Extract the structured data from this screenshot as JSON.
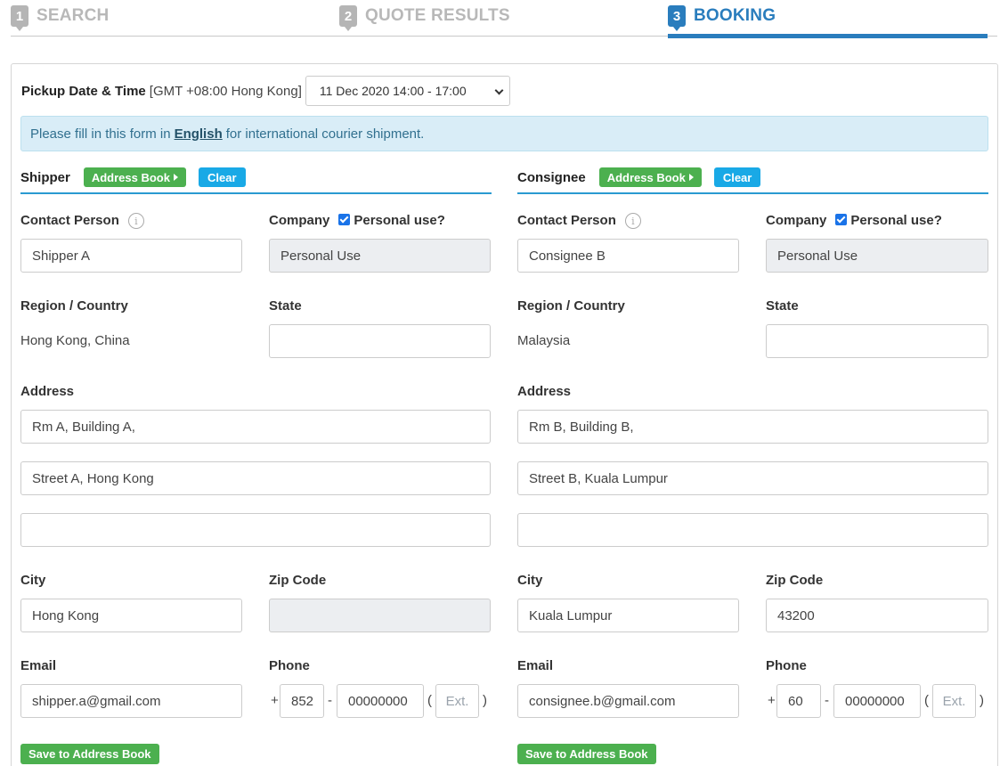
{
  "steps": [
    {
      "number": "1",
      "label": "SEARCH"
    },
    {
      "number": "2",
      "label": "QUOTE RESULTS"
    },
    {
      "number": "3",
      "label": "BOOKING"
    }
  ],
  "pickup": {
    "label": "Pickup Date & Time",
    "timezone": "[GMT +08:00 Hong Kong]",
    "selected": "11 Dec 2020 14:00 - 17:00"
  },
  "notice": {
    "before": "Please fill in this form in",
    "emphasis": "English",
    "after": "for international courier shipment."
  },
  "labels": {
    "address_book": "Address Book",
    "clear": "Clear",
    "contact_person": "Contact Person",
    "company": "Company",
    "personal_use": "Personal use?",
    "region_country": "Region / Country",
    "state": "State",
    "address": "Address",
    "city": "City",
    "zip_code": "Zip Code",
    "email": "Email",
    "phone": "Phone",
    "ext_placeholder": "Ext.",
    "save_to_address_book": "Save to Address Book",
    "plus": "+",
    "dash": "-",
    "paren_open": "(",
    "paren_close": ")"
  },
  "shipper": {
    "title": "Shipper",
    "contact_person": "Shipper A",
    "company": "Personal Use",
    "personal_use_checked": true,
    "region_country": "Hong Kong, China",
    "state": "",
    "address_line1": "Rm A, Building A,",
    "address_line2": "Street A, Hong Kong",
    "address_line3": "",
    "city": "Hong Kong",
    "zip_code": "",
    "email": "shipper.a@gmail.com",
    "phone_country_code": "852",
    "phone_number": "00000000",
    "phone_ext": ""
  },
  "consignee": {
    "title": "Consignee",
    "contact_person": "Consignee B",
    "company": "Personal Use",
    "personal_use_checked": true,
    "region_country": "Malaysia",
    "state": "",
    "address_line1": "Rm B, Building B,",
    "address_line2": "Street B, Kuala Lumpur",
    "address_line3": "",
    "city": "Kuala Lumpur",
    "zip_code": "43200",
    "email": "consignee.b@gmail.com",
    "phone_country_code": "60",
    "phone_number": "00000000",
    "phone_ext": ""
  },
  "colors": {
    "accent": "#2a7dbd",
    "success": "#4cb04f",
    "info": "#19a9e6",
    "notice_bg": "#d9edf7"
  }
}
